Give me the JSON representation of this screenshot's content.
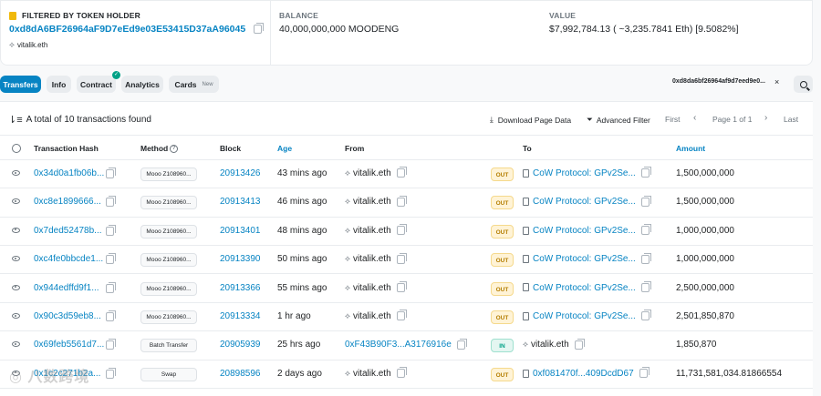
{
  "summary": {
    "filter_label": "FILTERED BY TOKEN HOLDER",
    "holder_address": "0xd8dA6BF26964aF9D7eEd9e03E53415D37aA96045",
    "holder_ens": "vitalik.eth",
    "balance_label": "BALANCE",
    "balance_value": "40,000,000,000 MOODENG",
    "value_label": "VALUE",
    "value_value": "$7,992,784.13 ( ~3,235.7841 Eth) [9.5082%]"
  },
  "tabs": {
    "transfers": "Transfers",
    "info": "Info",
    "contract": "Contract",
    "analytics": "Analytics",
    "cards": "Cards",
    "cards_badge": "New",
    "contract_check": "✓"
  },
  "filter_chip": {
    "text": "0xd8da6bf26964af9d7eed9e0...",
    "close": "×"
  },
  "toolbar": {
    "summary_text": "A total of 10 transactions found",
    "download": "Download Page Data",
    "advanced_filter": "Advanced Filter",
    "first": "First",
    "prev": "‹",
    "page_label": "Page 1 of 1",
    "next": "›",
    "last": "Last"
  },
  "table": {
    "headers": {
      "hash": "Transaction Hash",
      "method": "Method",
      "block": "Block",
      "age": "Age",
      "from": "From",
      "to": "To",
      "amount": "Amount"
    },
    "rows": [
      {
        "hash": "0x34d0a1fb06b...",
        "method": "Mooo Z108960...",
        "block": "20913426",
        "age": "43 mins ago",
        "from": "vitalik.eth",
        "dir": "OUT",
        "to": "CoW Protocol: GPv2Se...",
        "amount": "1,500,000,000"
      },
      {
        "hash": "0xc8e1899666...",
        "method": "Mooo Z108960...",
        "block": "20913413",
        "age": "46 mins ago",
        "from": "vitalik.eth",
        "dir": "OUT",
        "to": "CoW Protocol: GPv2Se...",
        "amount": "1,500,000,000"
      },
      {
        "hash": "0x7ded52478b...",
        "method": "Mooo Z108960...",
        "block": "20913401",
        "age": "48 mins ago",
        "from": "vitalik.eth",
        "dir": "OUT",
        "to": "CoW Protocol: GPv2Se...",
        "amount": "1,000,000,000"
      },
      {
        "hash": "0xc4fe0bbcde1...",
        "method": "Mooo Z108960...",
        "block": "20913390",
        "age": "50 mins ago",
        "from": "vitalik.eth",
        "dir": "OUT",
        "to": "CoW Protocol: GPv2Se...",
        "amount": "1,000,000,000"
      },
      {
        "hash": "0x944edffd9f1...",
        "method": "Mooo Z108960...",
        "block": "20913366",
        "age": "55 mins ago",
        "from": "vitalik.eth",
        "dir": "OUT",
        "to": "CoW Protocol: GPv2Se...",
        "amount": "2,500,000,000"
      },
      {
        "hash": "0x90c3d59eb8...",
        "method": "Mooo Z108960...",
        "block": "20913334",
        "age": "1 hr ago",
        "from": "vitalik.eth",
        "dir": "OUT",
        "to": "CoW Protocol: GPv2Se...",
        "amount": "2,501,850,870"
      },
      {
        "hash": "0x69feb5561d7...",
        "method": "Batch Transfer",
        "block": "20905939",
        "age": "25 hrs ago",
        "from": "0xF43B90F3...A3176916e",
        "dir": "IN",
        "to": "vitalik.eth",
        "amount": "1,850,870"
      },
      {
        "hash": "0x1c2c271b2a...",
        "method": "Swap",
        "block": "20898596",
        "age": "2 days ago",
        "from": "vitalik.eth",
        "dir": "OUT",
        "to": "0xf081470f...409DcdD67",
        "amount": "11,731,581,034.81866554"
      }
    ]
  },
  "watermark": "◎ 八数跨境"
}
